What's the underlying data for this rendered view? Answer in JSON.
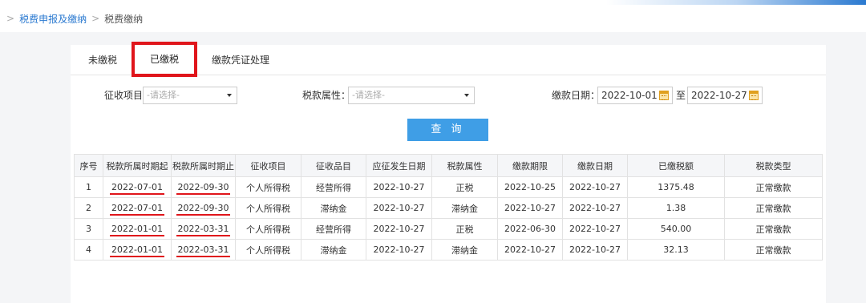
{
  "breadcrumb": {
    "root": "税费申报及缴纳",
    "current": "税费缴纳"
  },
  "tabs": {
    "unpaid": "未缴税",
    "paid": "已缴税",
    "voucher": "缴款凭证处理"
  },
  "filters": {
    "levy_item_label": "征收项目:",
    "levy_item_placeholder": "-请选择-",
    "tax_attr_label": "税款属性：",
    "tax_attr_placeholder": "-请选择-",
    "pay_date_label": "缴款日期：",
    "date_from": "2022-10-01",
    "date_sep": "至",
    "date_to": "2022-10-27"
  },
  "query_button": "查 询",
  "table": {
    "headers": [
      "序号",
      "税款所属时期起",
      "税款所属时期止",
      "征收项目",
      "征收品目",
      "应征发生日期",
      "税款属性",
      "缴款期限",
      "缴款日期",
      "已缴税额",
      "税款类型"
    ],
    "rows": [
      [
        "1",
        "2022-07-01",
        "2022-09-30",
        "个人所得税",
        "经营所得",
        "2022-10-27",
        "正税",
        "2022-10-25",
        "2022-10-27",
        "1375.48",
        "正常缴款"
      ],
      [
        "2",
        "2022-07-01",
        "2022-09-30",
        "个人所得税",
        "滞纳金",
        "2022-10-27",
        "滞纳金",
        "2022-10-27",
        "2022-10-27",
        "1.38",
        "正常缴款"
      ],
      [
        "3",
        "2022-01-01",
        "2022-03-31",
        "个人所得税",
        "经营所得",
        "2022-10-27",
        "正税",
        "2022-06-30",
        "2022-10-27",
        "540.00",
        "正常缴款"
      ],
      [
        "4",
        "2022-01-01",
        "2022-03-31",
        "个人所得税",
        "滞纳金",
        "2022-10-27",
        "滞纳金",
        "2022-10-27",
        "2022-10-27",
        "32.13",
        "正常缴款"
      ]
    ]
  },
  "colors": {
    "accent": "#3f9ee6",
    "link": "#2a79d0",
    "highlight": "#e0151b"
  },
  "icons": {
    "calendar": "calendar-icon",
    "dropdown": "chevron-down-icon"
  }
}
